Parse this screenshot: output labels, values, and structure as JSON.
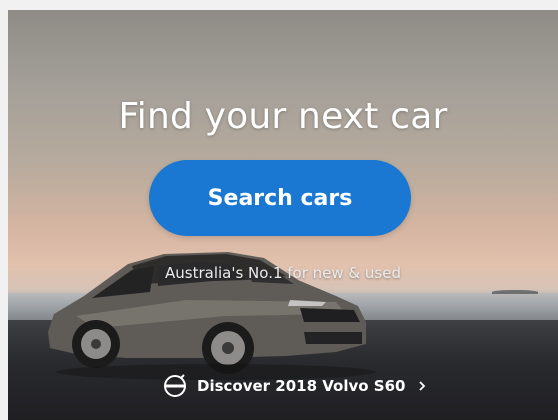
{
  "hero": {
    "title": "Find your next car",
    "search_button_label": "Search cars",
    "tagline": "Australia's No.1 for new & used",
    "discover_link_label": "Discover 2018 Volvo S60"
  },
  "icons": {
    "brand_logo": "volvo-logo-icon",
    "chevron": "chevron-right-icon"
  },
  "colors": {
    "search_button": "#1a77d2",
    "text": "#ffffff"
  }
}
